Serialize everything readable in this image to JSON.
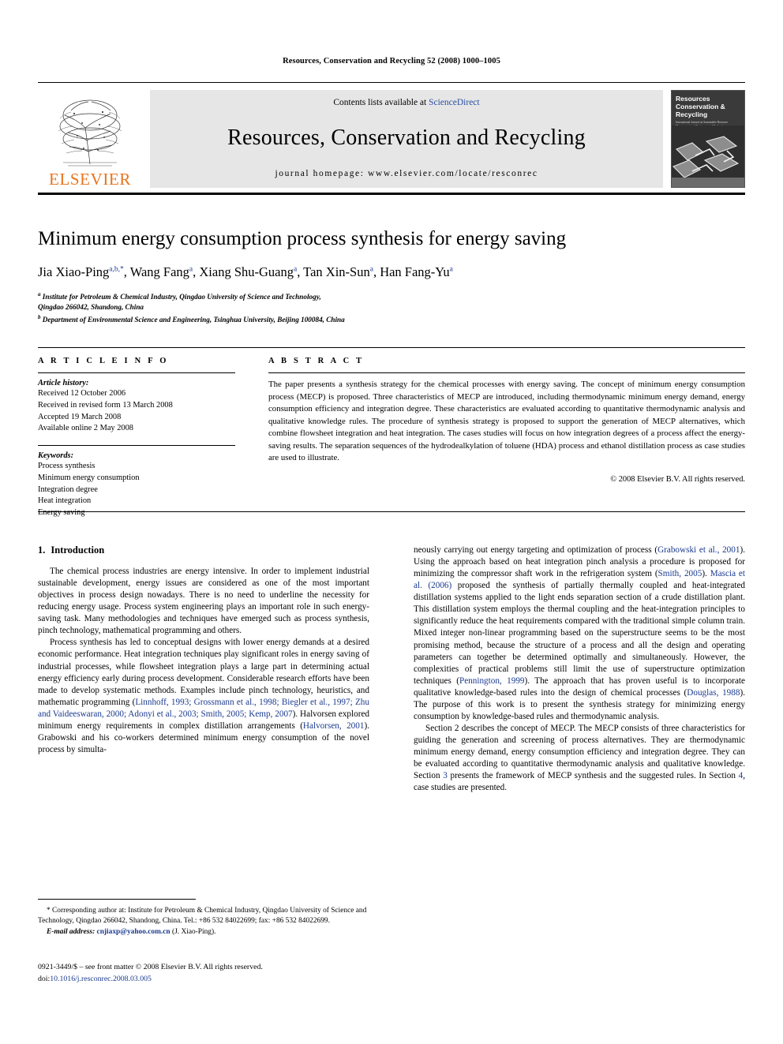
{
  "running_head": "Resources, Conservation and Recycling 52 (2008) 1000–1005",
  "masthead": {
    "contents_prefix": "Contents lists available at ",
    "sciencedirect": "ScienceDirect",
    "journal_name": "Resources, Conservation and Recycling",
    "homepage": "journal homepage: www.elsevier.com/locate/resconrec",
    "publisher_logo_text": "ELSEVIER",
    "cover_title_line1": "Resources",
    "cover_title_line2": "Conservation &",
    "cover_title_line3": "Recycling",
    "cover_sub": "International Journal on Sustainable Resource Management\nand Environmental Technology"
  },
  "article": {
    "title": "Minimum energy consumption process synthesis for energy saving",
    "authors_html": "Jia Xiao-Ping<sup>a,b,*</sup>, Wang Fang<sup>a</sup>, Xiang Shu-Guang<sup>a</sup>, Tan Xin-Sun<sup>a</sup>, Han Fang-Yu<sup>a</sup>",
    "affiliation_a_line1": "Institute for Petroleum & Chemical Industry, Qingdao University of Science and Technology,",
    "affiliation_a_line2": "Qingdao 266042, Shandong, China",
    "affiliation_b": "Department of Environmental Science and Engineering, Tsinghua University, Beijing 100084, China"
  },
  "info": {
    "heading": "A R T I C L E    I N F O",
    "history_label": "Article history:",
    "history": [
      "Received 12 October 2006",
      "Received in revised form 13 March 2008",
      "Accepted 19 March 2008",
      "Available online 2 May 2008"
    ],
    "keywords_label": "Keywords:",
    "keywords": [
      "Process synthesis",
      "Minimum energy consumption",
      "Integration degree",
      "Heat integration",
      "Energy saving"
    ]
  },
  "abstract": {
    "heading": "A B S T R A C T",
    "text": "The paper presents a synthesis strategy for the chemical processes with energy saving. The concept of minimum energy consumption process (MECP) is proposed. Three characteristics of MECP are introduced, including thermodynamic minimum energy demand, energy consumption efficiency and integration degree. These characteristics are evaluated according to quantitative thermodynamic analysis and qualitative knowledge rules. The procedure of synthesis strategy is proposed to support the generation of MECP alternatives, which combine flowsheet integration and heat integration. The cases studies will focus on how integration degrees of a process affect the energy-saving results. The separation sequences of the hydrodealkylation of toluene (HDA) process and ethanol distillation process as case studies are used to illustrate.",
    "copyright": "© 2008 Elsevier B.V. All rights reserved."
  },
  "sections": {
    "intro_number": "1.",
    "intro_title": "Introduction",
    "left_p1": "The chemical process industries are energy intensive. In order to implement industrial sustainable development, energy issues are considered as one of the most important objectives in process design nowadays. There is no need to underline the necessity for reducing energy usage. Process system engineering plays an important role in such energy-saving task. Many methodologies and techniques have emerged such as process synthesis, pinch technology, mathematical programming and others.",
    "left_p2_a": "Process synthesis has led to conceptual designs with lower energy demands at a desired economic performance. Heat integration techniques play significant roles in energy saving of industrial processes, while flowsheet integration plays a large part in determining actual energy efficiency early during process development. Considerable research efforts have been made to develop systematic methods. Examples include pinch technology, heuristics, and mathematic programming (",
    "left_cite_1": "Linnhoff, 1993; Grossmann et al., 1998; Biegler et al., 1997; Zhu and Vaideeswaran, 2000; Adonyi et al., 2003; Smith, 2005; Kemp, 2007",
    "left_p2_b": "). Halvorsen explored minimum energy requirements in complex distillation arrangements (",
    "left_cite_2": "Halvorsen, 2001",
    "left_p2_c": "). Grabowski and his co-workers determined minimum energy consumption of the novel process by simulta-",
    "right_p1_a": "neously carrying out energy targeting and optimization of process (",
    "right_cite_1": "Grabowski et al., 2001",
    "right_p1_b": "). Using the approach based on heat integration pinch analysis a procedure is proposed for minimizing the compressor shaft work in the refrigeration system (",
    "right_cite_2": "Smith, 2005",
    "right_p1_c": "). ",
    "right_cite_3": "Mascia et al. (2006)",
    "right_p1_d": " proposed the synthesis of partially thermally coupled and heat-integrated distillation systems applied to the light ends separation section of a crude distillation plant. This distillation system employs the thermal coupling and the heat-integration principles to significantly reduce the heat requirements compared with the traditional simple column train. Mixed integer non-linear programming based on the superstructure seems to be the most promising method, because the structure of a process and all the design and operating parameters can together be determined optimally and simultaneously. However, the complexities of practical problems still limit the use of superstructure optimization techniques (",
    "right_cite_4": "Pennington, 1999",
    "right_p1_e": "). The approach that has proven useful is to incorporate qualitative knowledge-based rules into the design of chemical processes (",
    "right_cite_5": "Douglas, 1988",
    "right_p1_f": "). The purpose of this work is to present the synthesis strategy for minimizing energy consumption by knowledge-based rules and thermodynamic analysis.",
    "right_p2_a": "Section 2 describes the concept of MECP. The MECP consists of three characteristics for guiding the generation and screening of process alternatives. They are thermodynamic minimum energy demand, energy consumption efficiency and integration degree. They can be evaluated according to quantitative thermodynamic analysis and qualitative knowledge. Section ",
    "right_cite_6": "3",
    "right_p2_b": " presents the framework of MECP synthesis and the suggested rules. In Section ",
    "right_cite_7": "4",
    "right_p2_c": ", case studies are presented."
  },
  "footnotes": {
    "corresponding": "* Corresponding author at: Institute for Petroleum & Chemical Industry, Qingdao University of Science and Technology, Qingdao 266042, Shandong, China. Tel.: +86 532 84022699; fax: +86 532 84022699.",
    "email_label": "E-mail address:",
    "email": "cnjiaxp@yahoo.com.cn",
    "email_suffix": "(J. Xiao-Ping)."
  },
  "imprint": {
    "issn_line": "0921-3449/$ – see front matter © 2008 Elsevier B.V. All rights reserved.",
    "doi_label": "doi:",
    "doi": "10.1016/j.resconrec.2008.03.005"
  },
  "colors": {
    "link": "#1a3a8f",
    "elsevier_orange": "#E8731B",
    "band_gray": "#e6e6e6"
  }
}
